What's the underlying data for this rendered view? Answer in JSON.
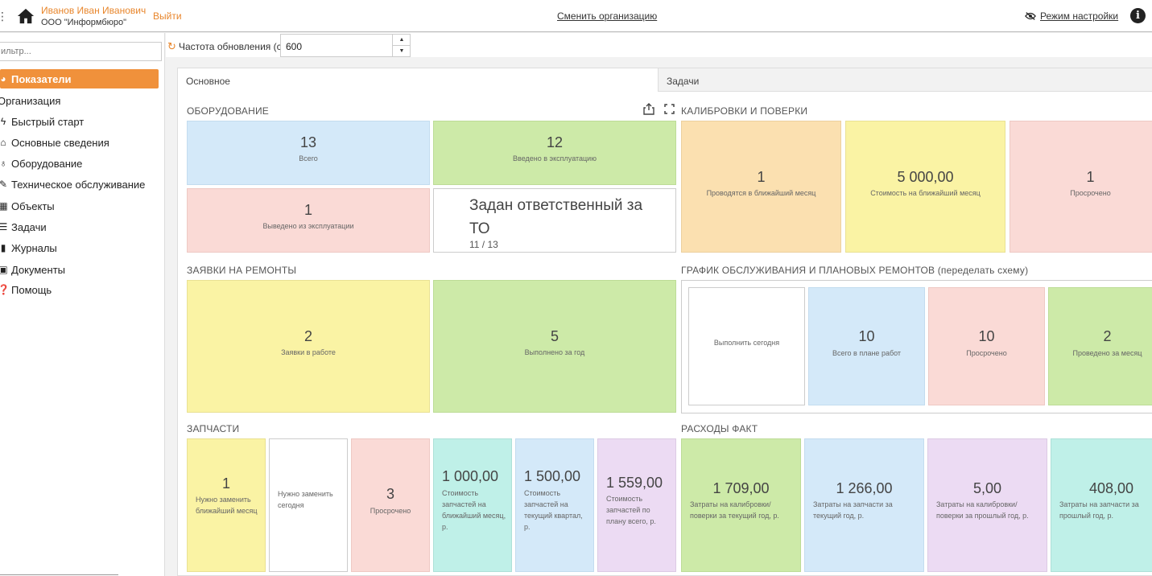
{
  "header": {
    "user_name": "Иванов Иван Иванович",
    "user_org": "ООО \"Информбюро\"",
    "logout": "Выйти",
    "change_org": "Сменить организацию",
    "settings_mode": "Режим настройки",
    "icons": [
      "home-icon",
      "eye-off-icon",
      "info-icon"
    ]
  },
  "sidebar": {
    "filter_placeholder": "ильтр...",
    "items": [
      {
        "label": "Показатели",
        "icon": "chart-icon",
        "active": true
      },
      {
        "label": "Организация",
        "icon": "",
        "active": false
      },
      {
        "label": "Быстрый старт",
        "icon": "bolt-icon",
        "active": false
      },
      {
        "label": "Основные сведения",
        "icon": "bank-icon",
        "active": false
      },
      {
        "label": "Оборудование",
        "icon": "equipment-icon",
        "active": false
      },
      {
        "label": "Техническое обслуживание",
        "icon": "wrench-icon",
        "active": false
      },
      {
        "label": "Объекты",
        "icon": "grid-icon",
        "active": false
      },
      {
        "label": "Задачи",
        "icon": "list-icon",
        "active": false
      },
      {
        "label": "Журналы",
        "icon": "book-icon",
        "active": false
      },
      {
        "label": "Документы",
        "icon": "briefcase-icon",
        "active": false
      },
      {
        "label": "Помощь",
        "icon": "question-icon",
        "active": false
      }
    ]
  },
  "refresh": {
    "label": "Частота обновления (с)",
    "value": "600"
  },
  "tabs": {
    "main": "Основное",
    "tasks": "Задачи"
  },
  "equipment": {
    "title": "ОБОРУДОВАНИЕ",
    "total_num": "13",
    "total_label": "Всего",
    "commissioned_num": "12",
    "commissioned_label": "Введено в эксплуатацию",
    "decommissioned_num": "1",
    "decommissioned_label": "Выведено из эксплуатации",
    "responsible_title": "Задан ответственный за ТО",
    "responsible_value": "11 / 13"
  },
  "calibration": {
    "title": "КАЛИБРОВКИ И ПОВЕРКИ",
    "next_month_num": "1",
    "next_month_label": "Проводятся в ближайший месяц",
    "cost_num": "5 000,00",
    "cost_label": "Стоимость на ближайший месяц",
    "overdue_num": "1",
    "overdue_label": "Просрочено"
  },
  "repairs": {
    "title": "ЗАЯВКИ НА РЕМОНТЫ",
    "in_work_num": "2",
    "in_work_label": "Заявки в работе",
    "done_num": "5",
    "done_label": "Выполнено за год"
  },
  "schedule": {
    "title": "ГРАФИК ОБСЛУЖИВАНИЯ И ПЛАНОВЫХ РЕМОНТОВ (переделать схему)",
    "today_label": "Выполнить сегодня",
    "plan_num": "10",
    "plan_label": "Всего в плане работ",
    "overdue_num": "10",
    "overdue_label": "Просрочено",
    "month_num": "2",
    "month_label": "Проведено за месяц"
  },
  "parts": {
    "title": "ЗАПЧАСТИ",
    "replace_month_num": "1",
    "replace_month_label": "Нужно заменить ближайший месяц",
    "replace_today_label": "Нужно заменить сегодня",
    "overdue_num": "3",
    "overdue_label": "Просрочено",
    "cost_month_num": "1 000,00",
    "cost_month_label": "Стоимость запчастей на ближайший месяц, р.",
    "cost_quarter_num": "1 500,00",
    "cost_quarter_label": "Стоимость запчастей на текущий квартал, р.",
    "cost_plan_num": "1 559,00",
    "cost_plan_label": "Стоимость запчастей по плану всего, р."
  },
  "expenses": {
    "title": "РАСХОДЫ ФАКТ",
    "calib_current_num": "1 709,00",
    "calib_current_label": "Затраты на калибровки/поверки за текущий год, р.",
    "parts_current_num": "1 266,00",
    "parts_current_label": "Затраты на запчасти за текущий год, р.",
    "calib_prev_num": "5,00",
    "calib_prev_label": "Затраты на калибровки/поверки за прошлый год, р.",
    "parts_prev_num": "408,00",
    "parts_prev_label": "Затраты на запчасти за прошлый год, р."
  },
  "colors": {
    "accent": "#f0913b",
    "blue": "#d4e9f9",
    "green": "#cdeaa8",
    "pink": "#fadad6",
    "orange": "#fbe0b0",
    "yellow": "#faf3a4",
    "teal": "#bff0e8",
    "lavender": "#ecdbf3"
  }
}
